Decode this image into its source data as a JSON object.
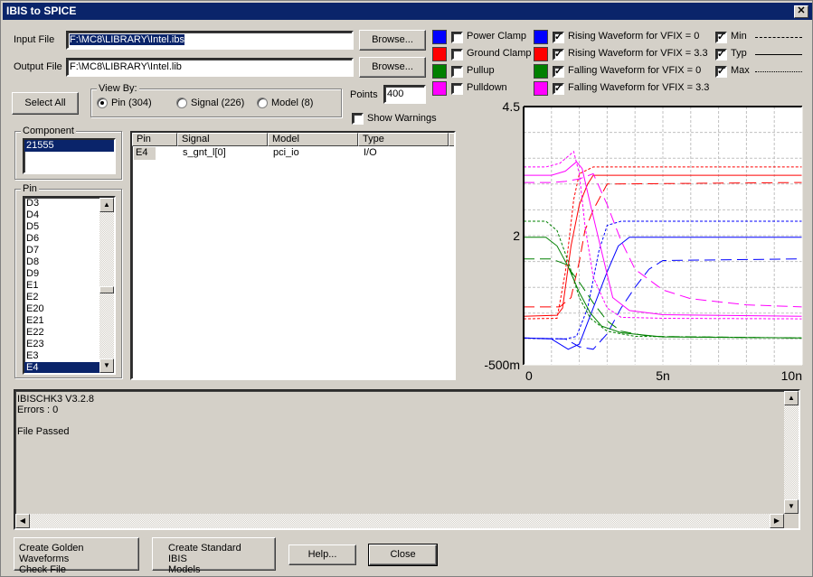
{
  "window": {
    "title": "IBIS to SPICE"
  },
  "files": {
    "input_label": "Input File",
    "input_value": "F:\\MC8\\LIBRARY\\Intel.ibs",
    "output_label": "Output File",
    "output_value": "F:\\MC8\\LIBRARY\\Intel.lib",
    "browse_label": "Browse..."
  },
  "select_all_label": "Select All",
  "view_by": {
    "title": "View By:",
    "options": [
      {
        "label": "Pin (304)",
        "selected": true
      },
      {
        "label": "Signal (226)",
        "selected": false
      },
      {
        "label": "Model (8)",
        "selected": false
      }
    ]
  },
  "points": {
    "label": "Points",
    "value": "400"
  },
  "show_warnings": {
    "label": "Show Warnings",
    "checked": false
  },
  "curves_legend": [
    {
      "label": "Power Clamp",
      "color": "#0000ff",
      "checked": false
    },
    {
      "label": "Ground Clamp",
      "color": "#ff0000",
      "checked": false
    },
    {
      "label": "Pullup",
      "color": "#008000",
      "checked": false
    },
    {
      "label": "Pulldown",
      "color": "#ff00ff",
      "checked": false
    }
  ],
  "waveforms_legend": [
    {
      "label": "Rising Waveform for VFIX = 0",
      "color": "#0000ff",
      "checked": true
    },
    {
      "label": "Rising Waveform for VFIX = 3.3",
      "color": "#ff0000",
      "checked": true
    },
    {
      "label": "Falling Waveform for VFIX = 0",
      "color": "#008000",
      "checked": true
    },
    {
      "label": "Falling Waveform for VFIX = 3.3",
      "color": "#ff00ff",
      "checked": true
    }
  ],
  "corners_legend": [
    {
      "label": "Min",
      "checked": true,
      "style": "long-dash"
    },
    {
      "label": "Typ",
      "checked": true,
      "style": "solid"
    },
    {
      "label": "Max",
      "checked": true,
      "style": "short-dash"
    }
  ],
  "component": {
    "title": "Component",
    "items": [
      "21555"
    ],
    "selected": "21555"
  },
  "pin": {
    "title": "Pin",
    "items": [
      "D3",
      "D4",
      "D5",
      "D6",
      "D7",
      "D8",
      "D9",
      "E1",
      "E2",
      "E20",
      "E21",
      "E22",
      "E23",
      "E3",
      "E4"
    ],
    "selected": "E4"
  },
  "pin_table": {
    "columns": [
      "Pin",
      "Signal",
      "Model",
      "Type"
    ],
    "rows": [
      [
        "E4",
        "s_gnt_l[0]",
        "pci_io",
        "I/O"
      ]
    ]
  },
  "log": {
    "lines": [
      "IBISCHK3 V3.2.8",
      "Errors  : 0",
      "",
      "File Passed"
    ]
  },
  "buttons": {
    "golden_line1": "Create Golden Waveforms",
    "golden_line2": "Check File",
    "standard_line1": "Create Standard IBIS",
    "standard_line2": "Models",
    "help": "Help...",
    "close": "Close"
  },
  "chart_data": {
    "type": "line",
    "title": "",
    "xlabel": "",
    "ylabel": "",
    "xlim": [
      0,
      10
    ],
    "ylim": [
      -0.5,
      4.5
    ],
    "x_unit": "ns",
    "y_unit": "V",
    "x_ticks": [
      "0",
      "5n",
      "10n"
    ],
    "y_ticks": [
      "4.5",
      "2",
      "-500m"
    ],
    "y_tick_values": [
      4.5,
      2,
      -0.5
    ],
    "x_tick_values": [
      0,
      5,
      10
    ],
    "grid": true,
    "series": [
      {
        "name": "Rising VFIX=0 Max",
        "color": "#0000ff",
        "style": "short-dash",
        "x": [
          0,
          1.5,
          1.9,
          2.3,
          2.7,
          3.0,
          3.5,
          10
        ],
        "y": [
          0.02,
          0.0,
          0.05,
          0.6,
          1.7,
          2.2,
          2.28,
          2.28
        ]
      },
      {
        "name": "Rising VFIX=0 Typ",
        "color": "#0000ff",
        "style": "solid",
        "x": [
          0,
          1.0,
          1.6,
          2.0,
          2.5,
          3.0,
          3.4,
          3.8,
          10
        ],
        "y": [
          0.02,
          0.0,
          -0.2,
          -0.1,
          0.6,
          1.3,
          1.8,
          1.97,
          1.97
        ]
      },
      {
        "name": "Rising VFIX=0 Min",
        "color": "#0000ff",
        "style": "long-dash",
        "x": [
          0,
          1.5,
          2.0,
          2.5,
          3.0,
          3.5,
          4.0,
          4.5,
          5.0,
          10
        ],
        "y": [
          0.02,
          0.0,
          -0.15,
          -0.2,
          0.1,
          0.6,
          1.0,
          1.35,
          1.52,
          1.55
        ]
      },
      {
        "name": "Rising VFIX=3.3 Max",
        "color": "#ff0000",
        "style": "short-dash",
        "x": [
          0,
          1.2,
          1.5,
          1.8,
          2.0,
          2.5,
          10
        ],
        "y": [
          0.39,
          0.4,
          1.3,
          2.7,
          3.2,
          3.33,
          3.33
        ]
      },
      {
        "name": "Rising VFIX=3.3 Typ",
        "color": "#ff0000",
        "style": "solid",
        "x": [
          0,
          1.2,
          1.4,
          1.7,
          2.0,
          2.3,
          2.5,
          10
        ],
        "y": [
          0.44,
          0.46,
          0.6,
          1.8,
          2.6,
          3.0,
          3.17,
          3.17
        ]
      },
      {
        "name": "Rising VFIX=3.3 Min",
        "color": "#ff0000",
        "style": "long-dash",
        "x": [
          0,
          1.3,
          1.7,
          2.0,
          2.2,
          2.5,
          3.0,
          10
        ],
        "y": [
          0.62,
          0.62,
          0.8,
          1.5,
          2.1,
          2.5,
          3.0,
          3.03
        ]
      },
      {
        "name": "Falling VFIX=0 Max",
        "color": "#008000",
        "style": "short-dash",
        "x": [
          0,
          0.8,
          1.2,
          1.6,
          2.0,
          2.4,
          3.0,
          4.0,
          10
        ],
        "y": [
          2.28,
          2.28,
          2.1,
          1.5,
          0.8,
          0.4,
          0.15,
          0.05,
          0.02
        ]
      },
      {
        "name": "Falling VFIX=0 Typ",
        "color": "#008000",
        "style": "solid",
        "x": [
          0,
          0.8,
          1.2,
          1.6,
          2.0,
          2.4,
          2.8,
          3.5,
          5.0,
          10
        ],
        "y": [
          1.97,
          1.97,
          1.8,
          1.4,
          0.9,
          0.5,
          0.25,
          0.12,
          0.04,
          0.02
        ]
      },
      {
        "name": "Falling VFIX=0 Min",
        "color": "#008000",
        "style": "long-dash",
        "x": [
          0,
          1.0,
          1.5,
          2.0,
          2.5,
          3.0,
          3.5,
          4.5,
          10
        ],
        "y": [
          1.55,
          1.55,
          1.45,
          1.1,
          0.7,
          0.35,
          0.15,
          0.05,
          0.02
        ]
      },
      {
        "name": "Falling VFIX=3.3 Max",
        "color": "#ff00ff",
        "style": "short-dash",
        "x": [
          0,
          0.8,
          1.3,
          1.8,
          2.0,
          2.2,
          2.5,
          3.0,
          3.5,
          5.0,
          10
        ],
        "y": [
          3.33,
          3.33,
          3.4,
          3.63,
          3.2,
          2.2,
          1.2,
          0.6,
          0.42,
          0.4,
          0.39
        ]
      },
      {
        "name": "Falling VFIX=3.3 Typ",
        "color": "#ff00ff",
        "style": "solid",
        "x": [
          0,
          1.0,
          1.5,
          1.9,
          2.1,
          2.4,
          2.8,
          3.2,
          3.8,
          5.0,
          10
        ],
        "y": [
          3.17,
          3.17,
          3.25,
          3.43,
          3.3,
          2.6,
          1.7,
          0.8,
          0.55,
          0.47,
          0.44
        ]
      },
      {
        "name": "Falling VFIX=3.3 Min",
        "color": "#ff00ff",
        "style": "long-dash",
        "x": [
          0,
          1.0,
          1.5,
          2.0,
          2.5,
          3.0,
          3.5,
          4.0,
          5.0,
          6.0,
          8.0,
          10
        ],
        "y": [
          3.03,
          3.03,
          3.05,
          3.1,
          3.2,
          2.6,
          1.9,
          1.35,
          0.95,
          0.78,
          0.66,
          0.62
        ]
      }
    ]
  }
}
